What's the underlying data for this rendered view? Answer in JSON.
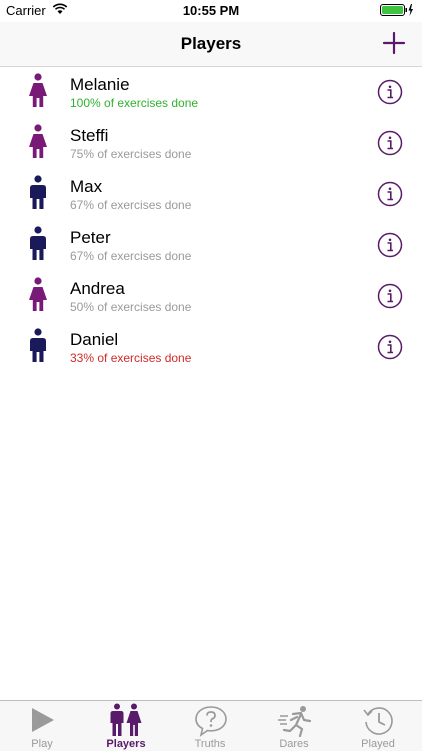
{
  "status": {
    "carrier": "Carrier",
    "time": "10:55 PM"
  },
  "header": {
    "title": "Players",
    "add_icon": "plus-icon"
  },
  "colors": {
    "accent": "#5a1a6a",
    "female": "#7a1a78",
    "male": "#1a1a5a",
    "complete": "#2db32d",
    "low": "#d12a2a",
    "neutral": "#9a9a9a"
  },
  "players": [
    {
      "name": "Melanie",
      "progress": "100% of exercises done",
      "gender": "female"
    },
    {
      "name": "Steffi",
      "progress": "75% of exercises done",
      "gender": "female"
    },
    {
      "name": "Max",
      "progress": "67% of exercises done",
      "gender": "male"
    },
    {
      "name": "Peter",
      "progress": "67% of exercises done",
      "gender": "male"
    },
    {
      "name": "Andrea",
      "progress": "50% of exercises done",
      "gender": "female"
    },
    {
      "name": "Daniel",
      "progress": "33% of exercises done",
      "gender": "male"
    }
  ],
  "tabs": [
    {
      "label": "Play",
      "icon": "play-icon"
    },
    {
      "label": "Players",
      "icon": "players-icon",
      "active": true
    },
    {
      "label": "Truths",
      "icon": "question-bubble-icon"
    },
    {
      "label": "Dares",
      "icon": "running-man-icon"
    },
    {
      "label": "Played",
      "icon": "history-clock-icon"
    }
  ]
}
